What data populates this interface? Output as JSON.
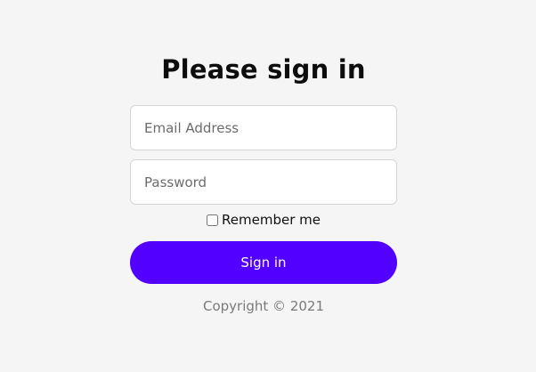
{
  "login": {
    "title": "Please sign in",
    "email": {
      "placeholder": "Email Address",
      "value": ""
    },
    "password": {
      "placeholder": "Password",
      "value": ""
    },
    "remember_label": "Remember me",
    "remember_checked": false,
    "submit_label": "Sign in",
    "copyright": "Copyright © 2021"
  },
  "colors": {
    "background": "#f5f5f5",
    "accent": "#5200ff",
    "muted_text": "#7a7a7a",
    "input_border": "#d4d4d4"
  }
}
